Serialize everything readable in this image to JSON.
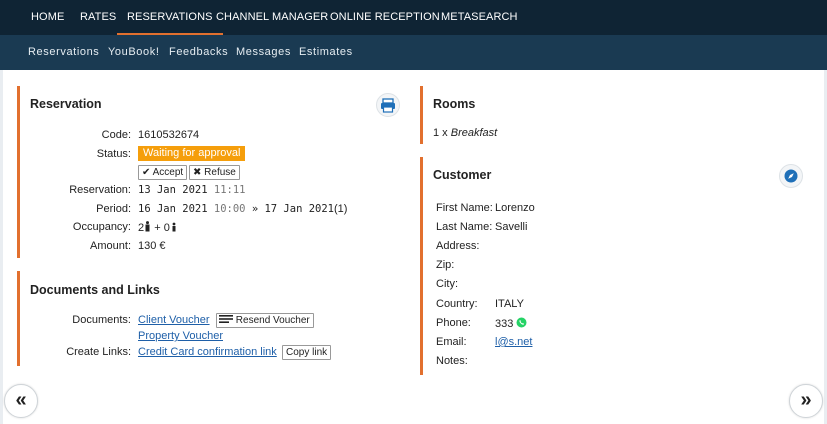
{
  "topnav": {
    "items": [
      "HOME",
      "RATES",
      "RESERVATIONS",
      "CHANNEL MANAGER",
      "ONLINE RECEPTION",
      "METASEARCH"
    ],
    "active": "RESERVATIONS"
  },
  "subnav": {
    "items": [
      "Reservations",
      "YouBook!",
      "Feedbacks",
      "Messages",
      "Estimates"
    ]
  },
  "reservation": {
    "title": "Reservation",
    "code_label": "Code:",
    "code": "1610532674",
    "status_label": "Status:",
    "status": "Waiting for approval",
    "status_color": "#f59e0b",
    "accept_label": "Accept",
    "refuse_label": "Refuse",
    "reservation_label": "Reservation:",
    "reservation_date": "13 Jan 2021",
    "reservation_time": "11:11",
    "period_label": "Period:",
    "period_from_date": "16 Jan 2021",
    "period_from_time": "10:00",
    "period_sep": "»",
    "period_to_date": "17 Jan 2021",
    "period_nights": "(1)",
    "occupancy_label": "Occupancy:",
    "occupancy_adults": "2",
    "occupancy_plus": "+",
    "occupancy_children": "0",
    "amount_label": "Amount:",
    "amount": "130 €"
  },
  "documents": {
    "title": "Documents and Links",
    "documents_label": "Documents:",
    "client_voucher": "Client Voucher",
    "resend_voucher": "Resend Voucher",
    "property_voucher": "Property Voucher",
    "create_links_label": "Create Links:",
    "cc_link": "Credit Card confirmation link",
    "copy_link": "Copy link"
  },
  "rooms": {
    "title": "Rooms",
    "qty": "1 x",
    "name": "Breakfast"
  },
  "customer": {
    "title": "Customer",
    "fields": [
      {
        "key": "First Name:",
        "value": "Lorenzo"
      },
      {
        "key": "Last Name:",
        "value": "Savelli"
      },
      {
        "key": "Address:",
        "value": ""
      },
      {
        "key": "Zip:",
        "value": ""
      },
      {
        "key": "City:",
        "value": ""
      },
      {
        "key": "Country:",
        "value": "ITALY"
      },
      {
        "key": "Phone:",
        "value": "333"
      },
      {
        "key": "Email:",
        "value": "l@s.net"
      },
      {
        "key": "Notes:",
        "value": ""
      }
    ]
  },
  "pager": {
    "prev": "«",
    "next": "»"
  },
  "colors": {
    "accent": "#e2702e",
    "topnav": "#0f2434",
    "subnav": "#1a3a52",
    "link": "#1e5fa8",
    "whatsapp": "#25d366"
  }
}
